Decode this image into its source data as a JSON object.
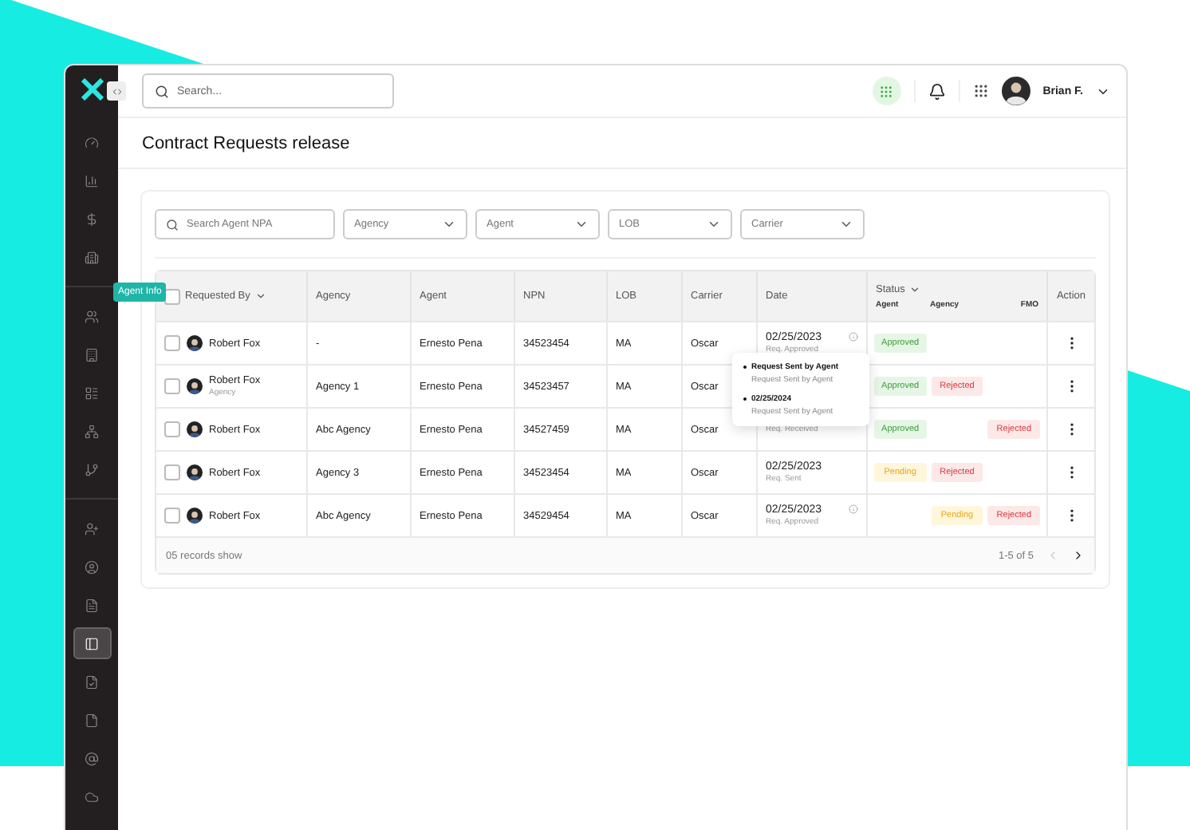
{
  "topbar": {
    "search": {
      "placeholder": "Search..."
    },
    "user": {
      "name": "Brian F."
    }
  },
  "sidebar": {
    "items": [
      {
        "selected": false
      },
      {
        "selected": false
      },
      {
        "selected": false
      },
      {
        "selected": false
      },
      {
        "selected": false
      },
      {
        "selected": false
      },
      {
        "selected": false
      },
      {
        "selected": false
      },
      {
        "selected": false
      },
      {
        "selected": false
      },
      {
        "selected": false
      },
      {
        "selected": false
      },
      {
        "selected": true
      },
      {
        "selected": false
      },
      {
        "selected": false
      },
      {
        "selected": false
      },
      {
        "selected": false
      }
    ],
    "tooltip": "Agent Info"
  },
  "page": {
    "title": "Contract Requests release"
  },
  "filters": {
    "search": {
      "placeholder": "Search Agent NPA"
    },
    "dropdowns": [
      "Agency",
      "Agent",
      "LOB",
      "Carrier"
    ]
  },
  "table": {
    "select_all_checked": false,
    "columns": {
      "requested_by": "Requested By",
      "agency": "Agency",
      "agent": "Agent",
      "npn": "NPN",
      "lob": "LOB",
      "carrier": "Carrier",
      "date": "Date",
      "status": "Status",
      "status_agent": "Agent",
      "status_agency": "Agency",
      "status_fmo": "FMO",
      "action": "Action"
    },
    "rows": [
      {
        "checked": false,
        "name": "Robert Fox",
        "agency": "-",
        "agent": "Ernesto Pena",
        "npn": "34523454",
        "lob": "MA",
        "carrier": "Oscar",
        "date": "02/25/2023",
        "date_note": "Req. Approved",
        "info": true,
        "status": {
          "agent": {
            "kind": "approved",
            "label": "Approved"
          }
        }
      },
      {
        "checked": false,
        "name": "Robert Fox",
        "role": "Agency",
        "agency": "Agency 1",
        "agent": "Ernesto Pena",
        "npn": "34523457",
        "lob": "MA",
        "carrier": "Oscar",
        "info": false,
        "status": {
          "agent": {
            "kind": "approved",
            "label": "Approved"
          },
          "agency": {
            "kind": "rejected",
            "label": "Rejected"
          }
        }
      },
      {
        "checked": false,
        "name": "Robert Fox",
        "agency": "Abc Agency",
        "agent": "Ernesto Pena",
        "npn": "34527459",
        "lob": "MA",
        "carrier": "Oscar",
        "date_note": "Req. Received",
        "info": false,
        "status": {
          "agent": {
            "kind": "approved",
            "label": "Approved"
          },
          "fmo": {
            "kind": "rejected",
            "label": "Rejected"
          }
        }
      },
      {
        "checked": false,
        "name": "Robert Fox",
        "agency": "Agency 3",
        "agent": "Ernesto Pena",
        "npn": "34523454",
        "lob": "MA",
        "carrier": "Oscar",
        "date": "02/25/2023",
        "date_note": "Req. Sent",
        "info": false,
        "status": {
          "agent": {
            "kind": "pending",
            "label": "Pending"
          },
          "agency": {
            "kind": "rejected",
            "label": "Rejected"
          }
        }
      },
      {
        "checked": false,
        "name": "Robert Fox",
        "agency": "Abc Agency",
        "agent": "Ernesto Pena",
        "npn": "34529454",
        "lob": "MA",
        "carrier": "Oscar",
        "date": "02/25/2023",
        "date_note": "Req. Approved",
        "info": true,
        "status": {
          "agency": {
            "kind": "pending",
            "label": "Pending"
          },
          "fmo": {
            "kind": "rejected",
            "label": "Rejected"
          }
        }
      }
    ],
    "footer": {
      "records": "05 records show",
      "range": "1-5 of 5"
    }
  },
  "popover": {
    "entries": [
      {
        "title": "Request Sent by Agent",
        "detail": "Request Sent by Agent"
      },
      {
        "title": "02/25/2024",
        "detail": "Request Sent by Agent"
      }
    ]
  }
}
